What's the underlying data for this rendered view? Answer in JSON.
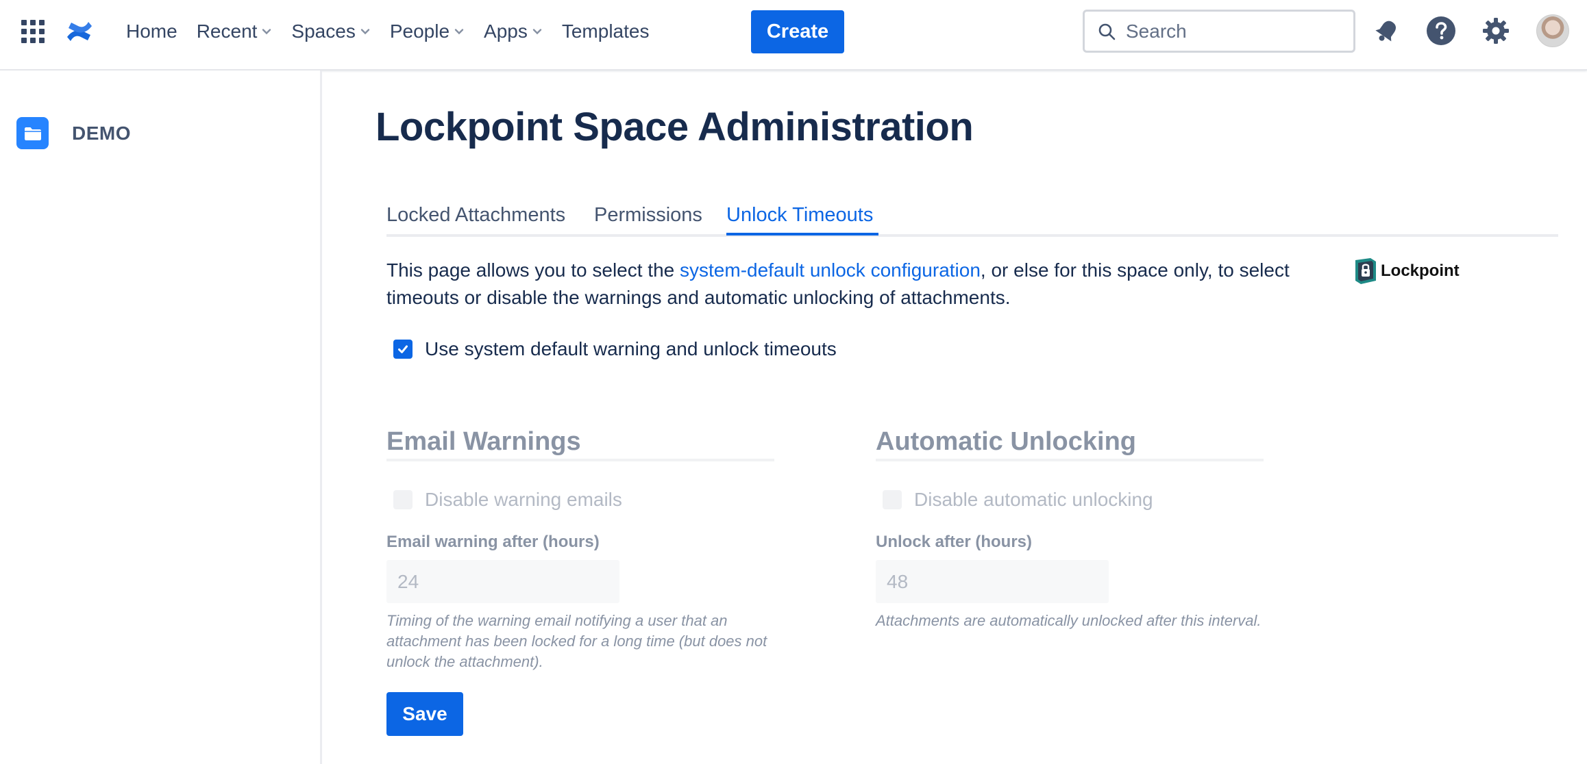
{
  "nav": {
    "items": [
      {
        "label": "Home",
        "dropdown": false
      },
      {
        "label": "Recent",
        "dropdown": true
      },
      {
        "label": "Spaces",
        "dropdown": true
      },
      {
        "label": "People",
        "dropdown": true
      },
      {
        "label": "Apps",
        "dropdown": true
      },
      {
        "label": "Templates",
        "dropdown": false
      }
    ],
    "create_label": "Create",
    "search_placeholder": "Search",
    "icons": [
      "app-switcher-icon",
      "confluence-logo",
      "notification-icon",
      "help-icon",
      "settings-icon",
      "avatar"
    ]
  },
  "sidebar": {
    "space_name": "DEMO"
  },
  "main": {
    "title": "Lockpoint Space Administration",
    "tabs": [
      {
        "label": "Locked Attachments",
        "active": false
      },
      {
        "label": "Permissions",
        "active": false
      },
      {
        "label": "Unlock Timeouts",
        "active": true
      }
    ],
    "intro_before": "This page allows you to select the ",
    "intro_link": "system-default unlock configuration",
    "intro_after": ", or else for this space only, to select timeouts or disable the warnings and automatic unlocking of attachments.",
    "brand_logo_text": "Lockpoint",
    "use_default": {
      "label": "Use system default warning and unlock timeouts",
      "checked": true
    },
    "email": {
      "title": "Email Warnings",
      "disable_label": "Disable warning emails",
      "disable_checked": false,
      "field_label": "Email warning after (hours)",
      "value": "24",
      "help": "Timing of the warning email notifying a user that an attachment has been locked for a long time (but does not unlock the attachment)."
    },
    "auto": {
      "title": "Automatic Unlocking",
      "disable_label": "Disable automatic unlocking",
      "disable_checked": false,
      "field_label": "Unlock after (hours)",
      "value": "48",
      "help": "Attachments are automatically unlocked after this interval."
    },
    "save_label": "Save"
  },
  "colors": {
    "primary": "#0c66e4",
    "text": "#172b4d",
    "disabled_text": "#b3b9c4",
    "space_icon": "#2684ff"
  }
}
